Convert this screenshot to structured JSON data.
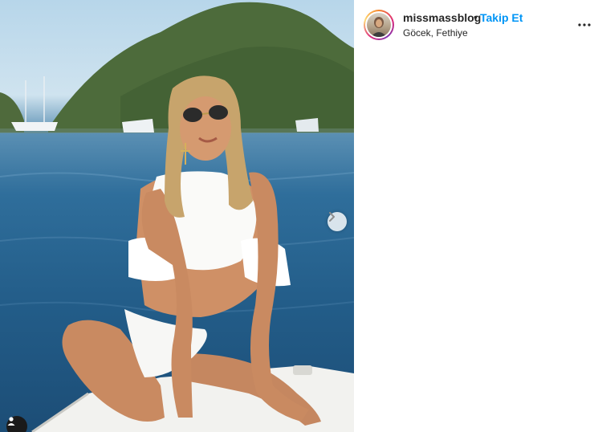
{
  "post": {
    "username": "missmassblog",
    "separator": "•",
    "follow_label": "Takip Et",
    "location": "Göcek, Fethiye"
  },
  "icons": {
    "next": "chevron-right-icon",
    "more": "more-options-icon",
    "tag": "user-tag-icon"
  },
  "colors": {
    "follow": "#0095f6",
    "text": "#262626"
  }
}
